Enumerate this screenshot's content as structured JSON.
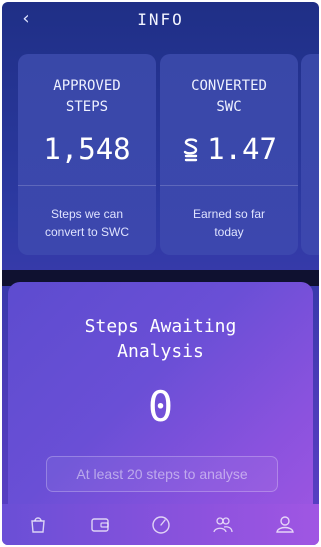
{
  "header": {
    "title": "INFO",
    "back_icon": "chevron-left-icon",
    "back_glyph": "‹"
  },
  "cards": [
    {
      "label_line1": "APPROVED",
      "label_line2": "STEPS",
      "value": "1,548",
      "sub_line1": "Steps we can",
      "sub_line2": "convert to SWC"
    },
    {
      "label_line1": "CONVERTED",
      "label_line2": "SWC",
      "coin_icon": "swc-coin-icon",
      "value": "1.47",
      "sub_line1": "Earned so far",
      "sub_line2": "today"
    }
  ],
  "awaiting": {
    "heading_line1": "Steps Awaiting",
    "heading_line2": "Analysis",
    "count": "0",
    "button_label": "At least 20 steps to analyse"
  },
  "tabbar": {
    "tabs": [
      "shop-bag-icon",
      "wallet-icon",
      "speedometer-icon",
      "friends-icon",
      "profile-icon"
    ]
  },
  "colors": {
    "background_top": "#1f2f86",
    "card": "#3948a8",
    "panel_accent": "#9a55e1",
    "text": "#ffffff"
  }
}
